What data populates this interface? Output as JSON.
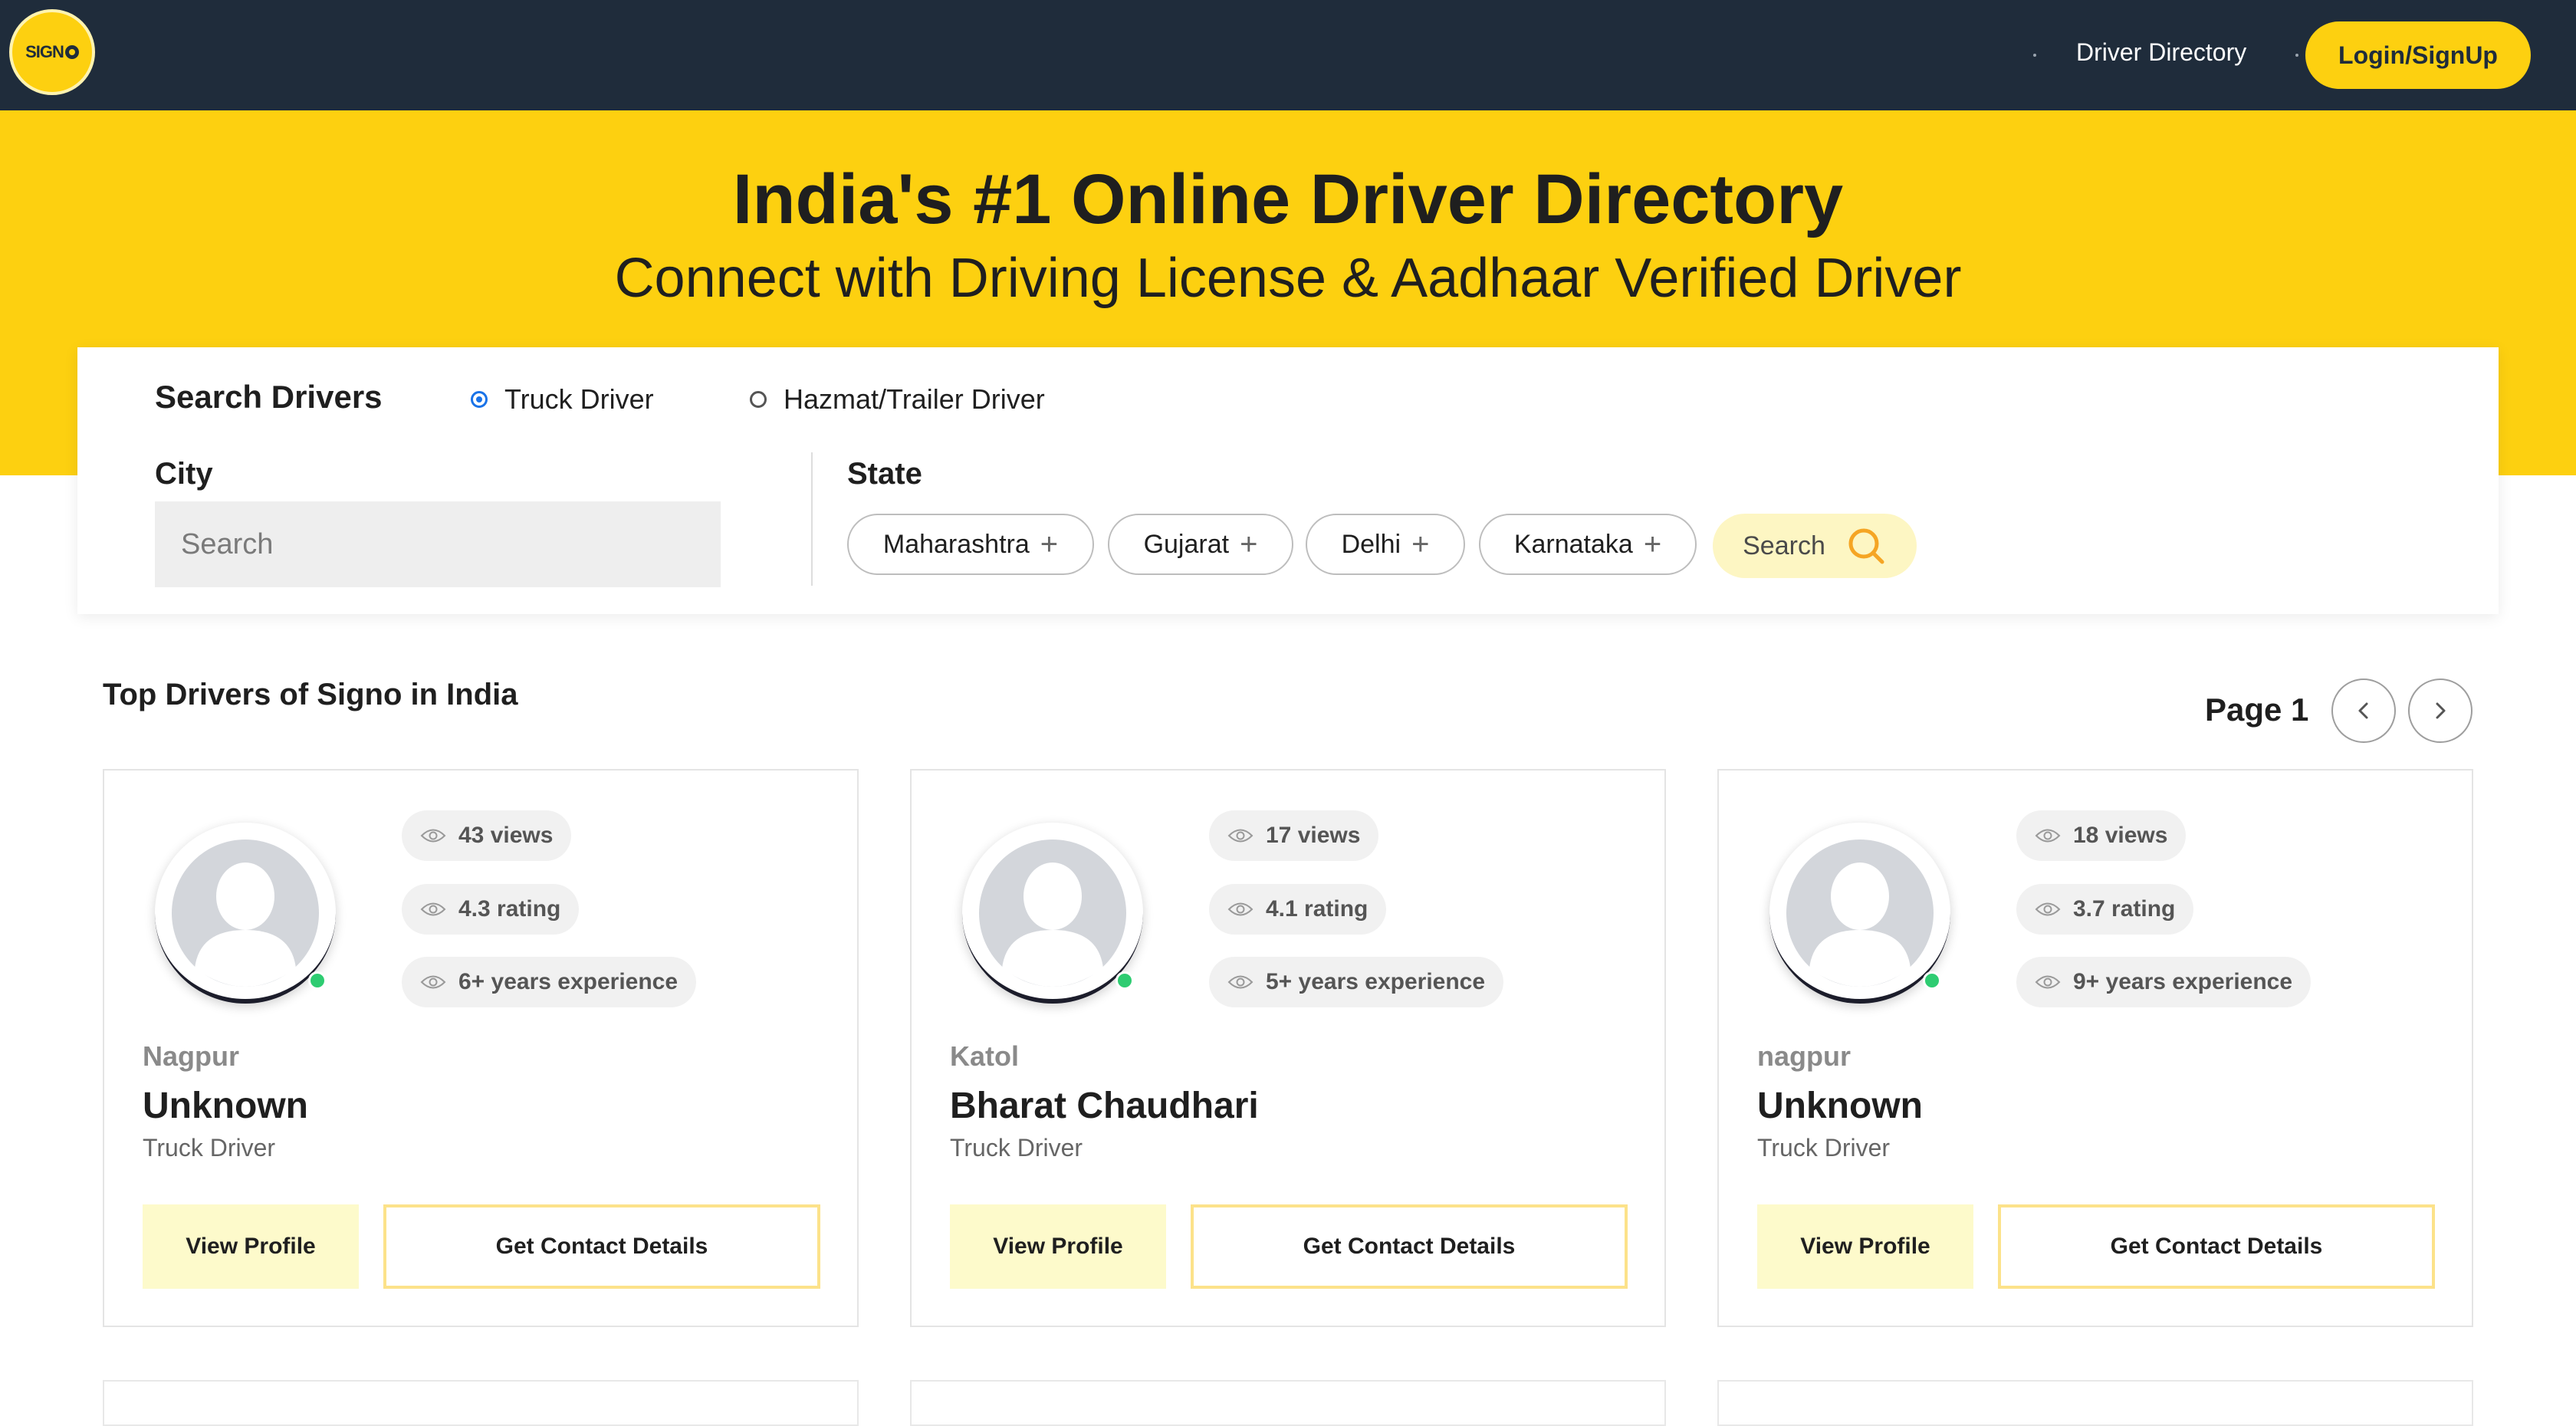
{
  "nav": {
    "logo_text": "SIGN",
    "driver_directory_label": "Driver Directory",
    "login_label": "Login/SignUp"
  },
  "hero": {
    "title": "India's #1 Online Driver Directory",
    "subtitle": "Connect with Driving License & Aadhaar Verified Driver"
  },
  "search": {
    "heading": "Search Drivers",
    "radio_options": [
      {
        "label": "Truck Driver",
        "checked": true
      },
      {
        "label": "Hazmat/Trailer Driver",
        "checked": false
      }
    ],
    "city_label": "City",
    "city_placeholder": "Search",
    "state_label": "State",
    "state_chips": [
      "Maharashtra",
      "Gujarat",
      "Delhi",
      "Karnataka"
    ],
    "search_button_label": "Search"
  },
  "listing": {
    "section_title": "Top Drivers of Signo in India",
    "page_label": "Page 1"
  },
  "drivers": [
    {
      "views": "43 views",
      "rating": "4.3 rating",
      "experience": "6+ years experience",
      "city": "Nagpur",
      "name": "Unknown",
      "role": "Truck Driver",
      "view_label": "View Profile",
      "contact_label": "Get Contact Details"
    },
    {
      "views": "17 views",
      "rating": "4.1 rating",
      "experience": "5+ years experience",
      "city": "Katol",
      "name": "Bharat Chaudhari",
      "role": "Truck Driver",
      "view_label": "View Profile",
      "contact_label": "Get Contact Details"
    },
    {
      "views": "18 views",
      "rating": "3.7 rating",
      "experience": "9+ years experience",
      "city": "nagpur",
      "name": "Unknown",
      "role": "Truck Driver",
      "view_label": "View Profile",
      "contact_label": "Get Contact Details"
    }
  ],
  "colors": {
    "navbar": "#1f2c3b",
    "brand_yellow": "#fdd010",
    "online_green": "#2ecc71",
    "radio_selected": "#1a73e8"
  },
  "icons": {
    "stat_icon": "eye-icon",
    "search_button_icon": "search-icon",
    "chip_icon": "plus-icon",
    "pager_prev": "chevron-left-icon",
    "pager_next": "chevron-right-icon"
  }
}
